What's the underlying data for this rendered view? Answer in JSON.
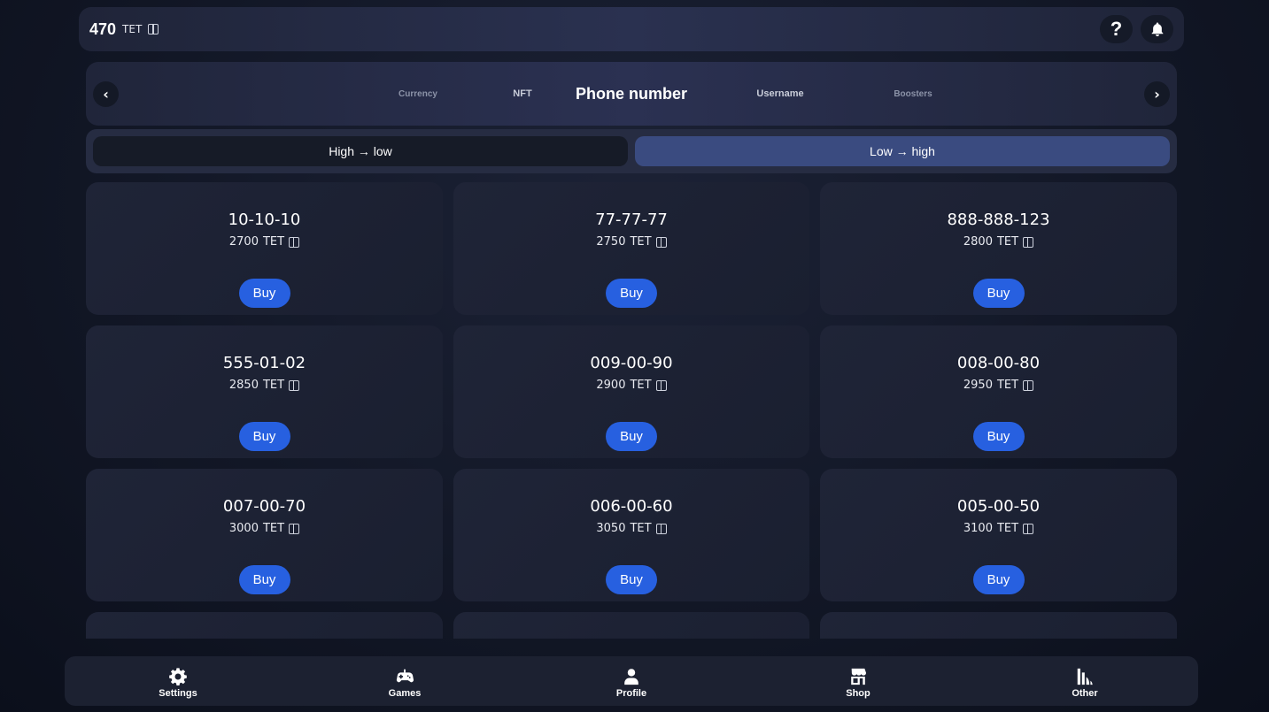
{
  "header": {
    "balance": "470",
    "currency": "TET",
    "help_label": "?"
  },
  "categories": {
    "prev": "‹",
    "next": "›",
    "items": [
      "Currency",
      "NFT",
      "Phone number",
      "Username",
      "Boosters"
    ],
    "active": "Phone number"
  },
  "sort": {
    "desc_label": "High → low",
    "asc_label": "Low → high",
    "active": "asc"
  },
  "products": [
    {
      "number": "10-10-10",
      "price": "2700",
      "currency": "TET",
      "buy_label": "Buy"
    },
    {
      "number": "77-77-77",
      "price": "2750",
      "currency": "TET",
      "buy_label": "Buy"
    },
    {
      "number": "888-888-123",
      "price": "2800",
      "currency": "TET",
      "buy_label": "Buy"
    },
    {
      "number": "555-01-02",
      "price": "2850",
      "currency": "TET",
      "buy_label": "Buy"
    },
    {
      "number": "009-00-90",
      "price": "2900",
      "currency": "TET",
      "buy_label": "Buy"
    },
    {
      "number": "008-00-80",
      "price": "2950",
      "currency": "TET",
      "buy_label": "Buy"
    },
    {
      "number": "007-00-70",
      "price": "3000",
      "currency": "TET",
      "buy_label": "Buy"
    },
    {
      "number": "006-00-60",
      "price": "3050",
      "currency": "TET",
      "buy_label": "Buy"
    },
    {
      "number": "005-00-50",
      "price": "3100",
      "currency": "TET",
      "buy_label": "Buy"
    }
  ],
  "bottom_nav": [
    {
      "label": "Settings",
      "icon": "gear-icon"
    },
    {
      "label": "Games",
      "icon": "gamepad-icon"
    },
    {
      "label": "Profile",
      "icon": "user-icon"
    },
    {
      "label": "Shop",
      "icon": "store-icon"
    },
    {
      "label": "Other",
      "icon": "chart-icon"
    }
  ]
}
